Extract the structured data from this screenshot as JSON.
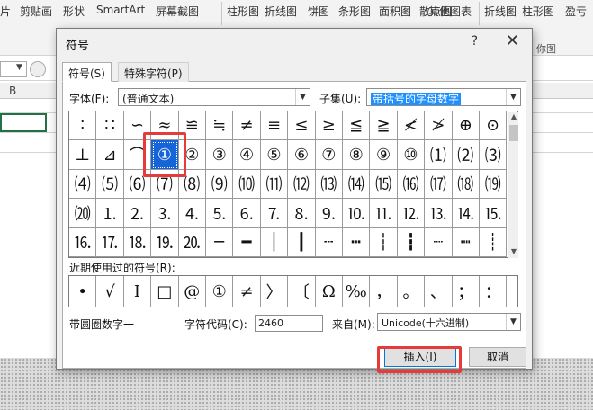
{
  "ribbon": {
    "items": [
      "片",
      "剪贴画",
      "形状",
      "SmartArt",
      "屏幕截图",
      "柱形图",
      "折线图",
      "饼图",
      "条形图",
      "面积图",
      "散点图",
      "其他图表",
      "折线图",
      "柱形图",
      "盈亏"
    ],
    "group_label": "你图"
  },
  "sheet": {
    "column_b": "B"
  },
  "dialog": {
    "title": "符号",
    "help": "?",
    "close": "✕",
    "tabs": [
      "符号(S)",
      "特殊字符(P)"
    ],
    "font_label": "字体(F):",
    "font_value": "(普通文本)",
    "subset_label": "子集(U):",
    "subset_value": "带括号的字母数字",
    "grid_rows": [
      [
        "∶",
        "∷",
        "∽",
        "≈",
        "≌",
        "≒",
        "≠",
        "≡",
        "≤",
        "≥",
        "≦",
        "≧",
        "≮",
        "≯",
        "⊕",
        "⊙"
      ],
      [
        "⊥",
        "⊿",
        "⌒",
        "①",
        "②",
        "③",
        "④",
        "⑤",
        "⑥",
        "⑦",
        "⑧",
        "⑨",
        "⑩",
        "⑴",
        "⑵",
        "⑶"
      ],
      [
        "⑷",
        "⑸",
        "⑹",
        "⑺",
        "⑻",
        "⑼",
        "⑽",
        "⑾",
        "⑿",
        "⒀",
        "⒁",
        "⒂",
        "⒃",
        "⒄",
        "⒅",
        "⒆"
      ],
      [
        "⒇",
        "⒈",
        "⒉",
        "⒊",
        "⒋",
        "⒌",
        "⒍",
        "⒎",
        "⒏",
        "⒐",
        "⒑",
        "⒒",
        "⒓",
        "⒔",
        "⒕",
        "⒖"
      ],
      [
        "⒗",
        "⒘",
        "⒙",
        "⒚",
        "⒛",
        "─",
        "━",
        "│",
        "┃",
        "┄",
        "┅",
        "┆",
        "┇",
        "┈",
        "┉",
        "┊"
      ]
    ],
    "selected_symbol": "①",
    "recent_label": "近期使用过的符号(R):",
    "recent": [
      "•",
      "√",
      "I",
      "□",
      "@",
      "①",
      "≠",
      "〉",
      "〔",
      "Ω",
      "‰",
      "，",
      "。",
      "、",
      "；",
      "："
    ],
    "char_name": "带圆圈数字一",
    "char_code_label": "字符代码(C):",
    "char_code": "2460",
    "from_label": "来自(M):",
    "from_value": "Unicode(十六进制)",
    "insert_button": "插入(I)",
    "cancel_button": "取消"
  },
  "colors": {
    "highlight": "#e53b3b",
    "selection": "#1565d8",
    "subset_selection": "#1e90ff"
  }
}
